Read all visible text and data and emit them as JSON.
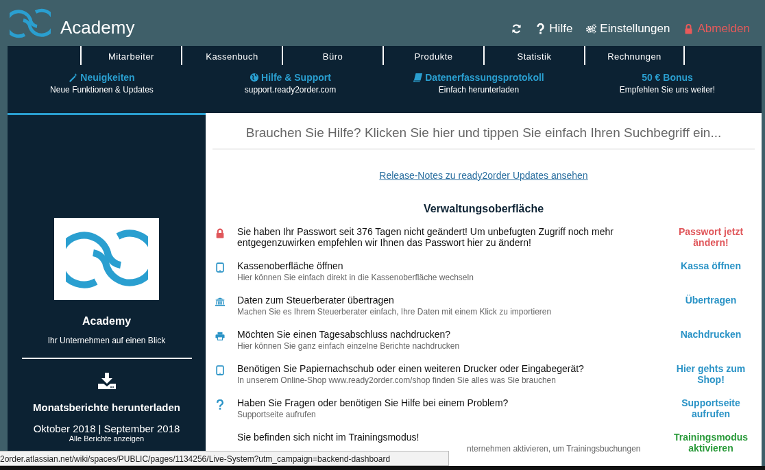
{
  "header": {
    "brand": "Academy",
    "links": [
      {
        "kind": "refresh"
      },
      {
        "kind": "help",
        "label": "Hilfe"
      },
      {
        "kind": "settings",
        "label": "Einstellungen"
      },
      {
        "kind": "logout",
        "label": "Abmelden"
      }
    ]
  },
  "nav": {
    "tabs": [
      "Mitarbeiter",
      "Kassenbuch",
      "Büro",
      "Produkte",
      "Statistik",
      "Rechnungen"
    ],
    "infos": [
      {
        "title": "Neuigkeiten",
        "subtitle": "Neue Funktionen & Updates"
      },
      {
        "title": "Hilfe & Support",
        "subtitle": "support.ready2order.com"
      },
      {
        "title": "Datenerfassungsprotokoll",
        "subtitle": "Einfach herunterladen"
      },
      {
        "title": "50 € Bonus",
        "subtitle": "Empfehlen Sie uns weiter!"
      }
    ]
  },
  "sidebar": {
    "company": "Academy",
    "tagline": "Ihr Unternehmen auf einen Blick",
    "download_title": "Monatsberichte herunterladen",
    "months": [
      "Oktober 2018",
      "September 2018"
    ],
    "month_separator": "|",
    "all_reports": "Alle Berichte anzeigen"
  },
  "main": {
    "search": {
      "placeholder": "Brauchen Sie Hilfe? Klicken Sie hier und tippen Sie einfach Ihren Suchbegriff ein..."
    },
    "release_link": "Release-Notes zu ready2order Updates ansehen",
    "heading": "Verwaltungsoberfläche",
    "rows": [
      {
        "kind": "danger",
        "title": "Sie haben Ihr Passwort seit 376 Tagen nicht geändert! Um unbefugten Zugriff noch mehr entgegenzuwirken empfehlen wir Ihnen das Passwort hier zu ändern!",
        "action": "Passwort jetzt ändern!"
      },
      {
        "kind": "primary",
        "title": "Kassenoberfläche öffnen",
        "subtitle": "Hier können Sie einfach direkt in die Kassenoberfläche wechseln",
        "action": "Kassa öffnen"
      },
      {
        "kind": "primary",
        "title": "Daten zum Steuerberater übertragen",
        "subtitle": "Machen Sie es Ihrem Steuerberater einfach, Ihre Daten mit einem Klick zu importieren",
        "action": "Übertragen"
      },
      {
        "kind": "primary",
        "title": "Möchten Sie einen Tagesabschluss nachdrucken?",
        "subtitle": "Hier können Sie ganz einfach einzelne Berichte nachdrucken",
        "action": "Nachdrucken"
      },
      {
        "kind": "primary",
        "title": "Benötigen Sie Papiernachschub oder einen weiteren Drucker oder Eingabegerät?",
        "subtitle": "In unserem Online-Shop www.ready2order.com/shop finden Sie alles was Sie brauchen",
        "action": "Hier gehts zum Shop!"
      },
      {
        "kind": "primary",
        "title": "Haben Sie Fragen oder benötigen Sie Hilfe bei einem Problem?",
        "subtitle": "Supportseite aufrufen",
        "action": "Supportseite aufrufen"
      },
      {
        "kind": "success",
        "title": "Sie befinden sich nicht im Trainingsmodus!",
        "subtitle_partial": "nternehmen aktivieren, um Trainingsbuchungen",
        "action": "Trainingsmodus aktivieren"
      }
    ]
  },
  "status_bar": {
    "url": "2order.atlassian.net/wiki/spaces/PUBLIC/pages/1134256/Live-System?utm_campaign=backend-dashboard"
  }
}
